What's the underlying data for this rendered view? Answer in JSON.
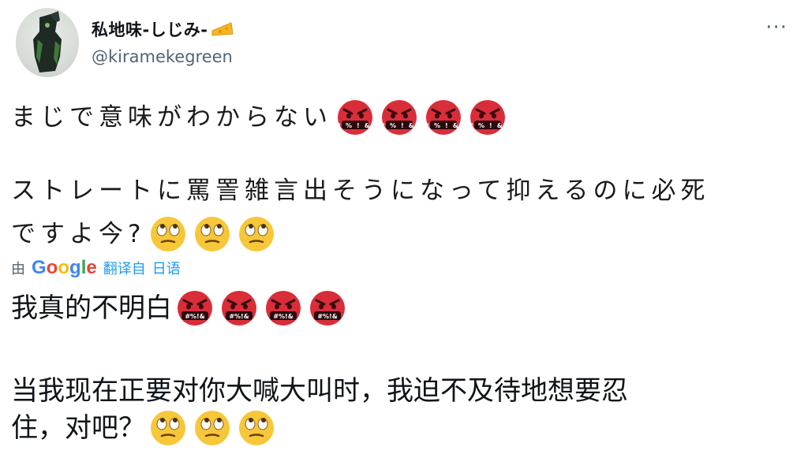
{
  "tweet": {
    "display_name": "私地味-しじみ-",
    "name_icon": "cheese-icon",
    "handle": "@kiramekegreen",
    "more_label": "···",
    "original": {
      "line1": "まじで意味がわからない",
      "line1_emoji": [
        "cursing-face-icon",
        "cursing-face-icon",
        "cursing-face-icon",
        "cursing-face-icon"
      ],
      "line2": "ストレートに罵詈雑言出そうになって抑えるのに必死",
      "line3": "ですよ今?",
      "line3_emoji": [
        "rolling-eyes-face-icon",
        "rolling-eyes-face-icon",
        "rolling-eyes-face-icon"
      ]
    },
    "translation_label": {
      "prefix": "由",
      "service": "Google",
      "suffix": "翻译自",
      "language": "日语"
    },
    "translated": {
      "line1": "我真的不明白",
      "line1_emoji": [
        "cursing-face-icon",
        "cursing-face-icon",
        "cursing-face-icon",
        "cursing-face-icon"
      ],
      "line2": "当我现在正要对你大喊大叫时，我迫不及待地想要忍",
      "line3": "住，对吧？",
      "line3_emoji": [
        "rolling-eyes-face-icon",
        "rolling-eyes-face-icon",
        "rolling-eyes-face-icon"
      ]
    },
    "colors": {
      "text": "#0f1419",
      "secondary": "#536471",
      "link": "#1d9bf0",
      "angry_face": "#d92d3a",
      "rolling_face": "#f7c73a"
    }
  }
}
